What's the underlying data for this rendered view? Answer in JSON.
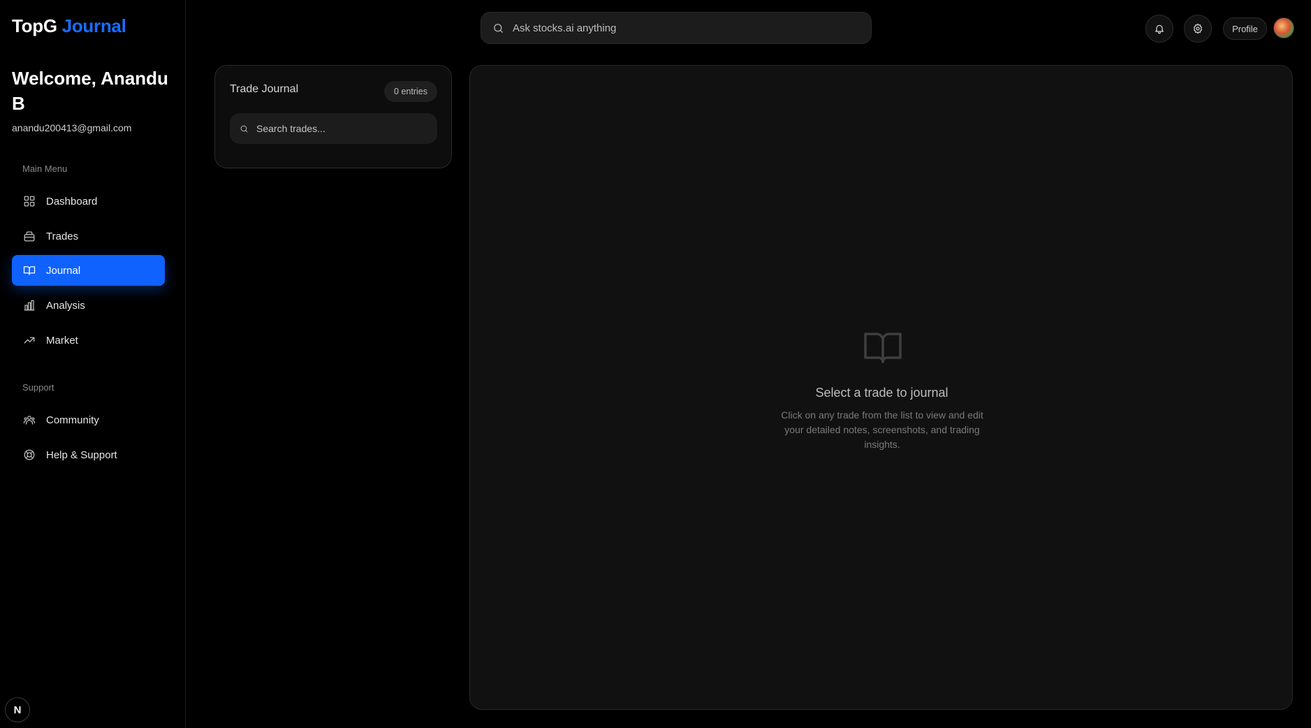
{
  "brand": {
    "part1": "TopG",
    "part2": "Journal",
    "accent_color": "#1a6dff"
  },
  "user": {
    "welcome": "Welcome, Anandu B",
    "email": "anandu200413@gmail.com"
  },
  "sidebar": {
    "main_menu_label": "Main Menu",
    "main_items": [
      {
        "label": "Dashboard",
        "icon": "grid-icon"
      },
      {
        "label": "Trades",
        "icon": "briefcase-icon"
      },
      {
        "label": "Journal",
        "icon": "book-icon",
        "active": true
      },
      {
        "label": "Analysis",
        "icon": "bar-chart-icon"
      },
      {
        "label": "Market",
        "icon": "trending-up-icon"
      }
    ],
    "support_label": "Support",
    "support_items": [
      {
        "label": "Community",
        "icon": "users-icon"
      },
      {
        "label": "Help & Support",
        "icon": "lifebuoy-icon"
      }
    ],
    "bottom_badge": "N"
  },
  "topbar": {
    "search_placeholder": "Ask stocks.ai anything",
    "profile_label": "Profile"
  },
  "journal": {
    "title": "Trade Journal",
    "entries": "0 entries",
    "search_placeholder": "Search trades..."
  },
  "empty_state": {
    "title": "Select a trade to journal",
    "description": "Click on any trade from the list to view and edit your detailed notes, screenshots, and trading insights."
  },
  "colors": {
    "active_nav": "#0f62fe",
    "background": "#000000",
    "panel": "#111111"
  }
}
